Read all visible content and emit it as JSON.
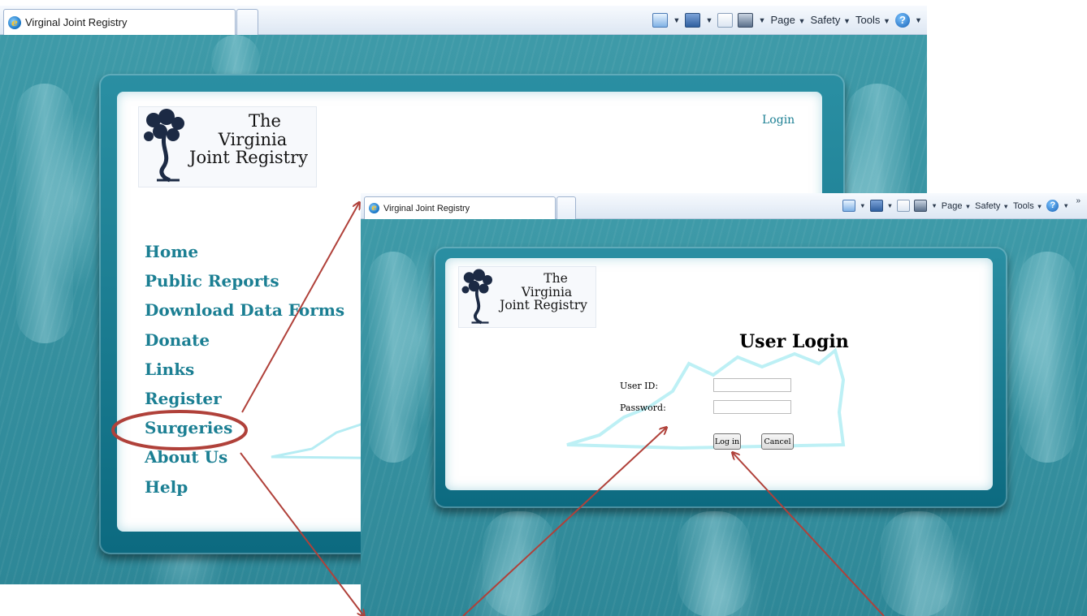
{
  "window_back": {
    "tab_title": "Virginal Joint Registry",
    "commands": [
      "Page",
      "Safety",
      "Tools"
    ],
    "login_link": "Login",
    "logo": {
      "line1": "The",
      "line2": "Virginia",
      "line3": "Joint Registry"
    },
    "nav_items": [
      "Home",
      "Public Reports",
      "Download Data Forms",
      "Donate",
      "Links",
      "Register",
      "Surgeries",
      "About Us",
      "Help"
    ],
    "highlighted_item": "Surgeries"
  },
  "window_front": {
    "tab_title": "Virginal Joint Registry",
    "commands": [
      "Page",
      "Safety",
      "Tools"
    ],
    "logo": {
      "line1": "The",
      "line2": "Virginia",
      "line3": "Joint Registry"
    },
    "form": {
      "title": "User Login",
      "user_id_label": "User ID:",
      "user_id_value": "",
      "password_label": "Password:",
      "password_value": "",
      "login_button": "Log in",
      "cancel_button": "Cancel"
    }
  },
  "icons": {
    "browser": "ie-logo-icon",
    "home": "home-icon",
    "feeds": "feeds-icon",
    "mail": "read-mail-icon",
    "print": "print-icon",
    "help": "help-icon"
  },
  "colors": {
    "accent_link": "#1b7f93",
    "background_teal": "#3594a3",
    "frame_teal": "#0c6a80",
    "annotation_red": "#b0413a"
  }
}
